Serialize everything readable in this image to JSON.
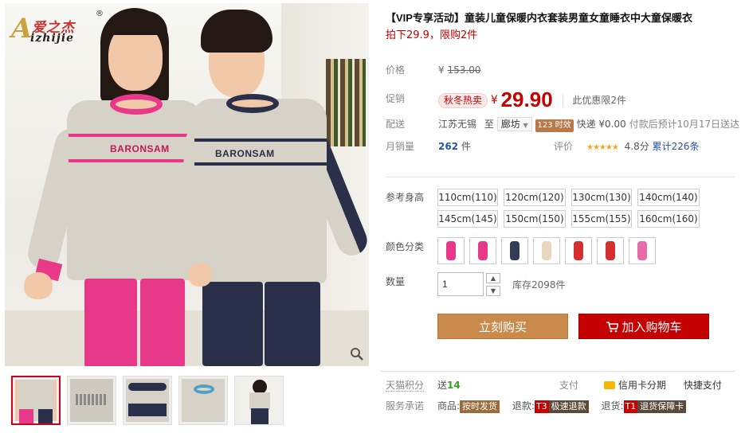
{
  "gallery": {
    "logo": {
      "letter": "A",
      "cn": "爱之杰",
      "en": "izhijie",
      "reg": "®"
    },
    "girl_shirt_text": "BARONSAM",
    "boy_shirt_text": "BARONSAM"
  },
  "product": {
    "title": "【VIP专享活动】童装儿童保暖内衣套装男童女童睡衣中大童保暖衣",
    "subtitle": "拍下29.9，限购2件"
  },
  "price": {
    "price_label": "价格",
    "original_currency": "¥",
    "original_price": "153.00",
    "promo_label": "促销",
    "promo_tag": "秋冬热卖",
    "promo_currency": "¥",
    "promo_price": "29.90",
    "limit_note": "此优惠限2件"
  },
  "shipping": {
    "label": "配送",
    "from": "江苏无锡",
    "to_word": "至",
    "to_city": "廊坊",
    "time_badge": "123 时效",
    "express": "快递 ¥0.00",
    "eta": "付款后预计10月17日送达"
  },
  "sales": {
    "label": "月销量",
    "count": "262",
    "unit": "件",
    "rating_label": "评价",
    "stars": "★★★★★",
    "score": "4.8分",
    "reviews": "累计226条"
  },
  "sizes": {
    "label": "参考身高",
    "options": [
      "110cm(110)",
      "120cm(120)",
      "130cm(130)",
      "140cm(140)",
      "145cm(145)",
      "150cm(150)",
      "155cm(155)",
      "160cm(160)"
    ]
  },
  "colors": {
    "label": "颜色分类",
    "swatches": [
      "#e8388a",
      "#e8388a",
      "#333c55",
      "#e8d8c0",
      "#d43030",
      "#d43030",
      "#e86aa8"
    ]
  },
  "quantity": {
    "label": "数量",
    "value": "1",
    "up": "▲",
    "down": "▼",
    "stock": "库存2098件"
  },
  "actions": {
    "buy_now": "立刻购买",
    "add_cart": "加入购物车"
  },
  "points": {
    "label": "天猫积分",
    "give": "送",
    "value": "14",
    "pay_label": "支付",
    "credit": "信用卡分期",
    "quick": "快捷支付"
  },
  "service": {
    "label": "服务承诺",
    "goods": "商品:",
    "goods_tag": "按时发货",
    "refund": "退款:",
    "refund_code": "T3",
    "refund_tag": "极速退款",
    "returns": "退货:",
    "returns_code": "T1",
    "returns_tag": "退货保障卡"
  },
  "colors_theme": {
    "accent_red": "#c40000",
    "buy_brown": "#c98a4c",
    "link_blue": "#2953a6"
  }
}
